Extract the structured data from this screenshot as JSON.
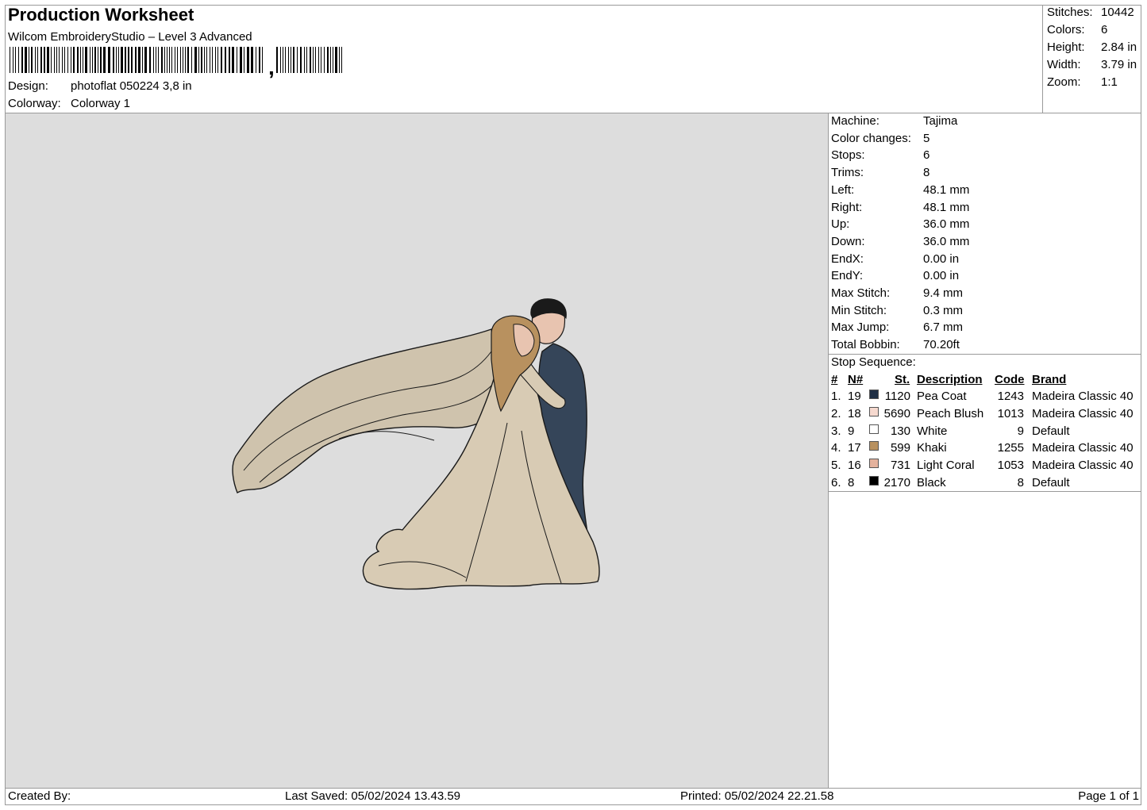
{
  "header": {
    "title": "Production Worksheet",
    "subtitle": "Wilcom EmbroideryStudio – Level 3 Advanced",
    "design_label": "Design:",
    "design_value": "photoflat 050224 3,8 in",
    "colorway_label": "Colorway:",
    "colorway_value": "Colorway 1"
  },
  "summary": [
    {
      "label": "Stitches:",
      "value": "10442"
    },
    {
      "label": "Colors:",
      "value": "6"
    },
    {
      "label": "Height:",
      "value": "2.84 in"
    },
    {
      "label": "Width:",
      "value": "3.79 in"
    },
    {
      "label": "Zoom:",
      "value": "1:1"
    }
  ],
  "machine_info": [
    {
      "label": "Machine:",
      "value": "Tajima"
    },
    {
      "label": "Color changes:",
      "value": "5"
    },
    {
      "label": "Stops:",
      "value": "6"
    },
    {
      "label": "Trims:",
      "value": "8"
    },
    {
      "label": "Left:",
      "value": "48.1 mm"
    },
    {
      "label": "Right:",
      "value": "48.1 mm"
    },
    {
      "label": "Up:",
      "value": "36.0 mm"
    },
    {
      "label": "Down:",
      "value": "36.0 mm"
    },
    {
      "label": "EndX:",
      "value": "0.00 in"
    },
    {
      "label": "EndY:",
      "value": "0.00 in"
    },
    {
      "label": "Max Stitch:",
      "value": "9.4 mm"
    },
    {
      "label": "Min Stitch:",
      "value": "0.3 mm"
    },
    {
      "label": "Max Jump:",
      "value": "6.7 mm"
    },
    {
      "label": "Total Bobbin:",
      "value": "70.20ft"
    }
  ],
  "stop_sequence": {
    "title": "Stop Sequence:",
    "columns": [
      "#",
      "N#",
      "St.",
      "Description",
      "Code",
      "Brand"
    ],
    "rows": [
      {
        "idx": "1.",
        "n": "19",
        "color": "#1f2f45",
        "st": "1120",
        "desc": "Pea Coat",
        "code": "1243",
        "brand": "Madeira Classic 40"
      },
      {
        "idx": "2.",
        "n": "18",
        "color": "#f6d9cf",
        "st": "5690",
        "desc": "Peach Blush",
        "code": "1013",
        "brand": "Madeira Classic 40"
      },
      {
        "idx": "3.",
        "n": "9",
        "color": "#ffffff",
        "st": "130",
        "desc": "White",
        "code": "9",
        "brand": "Default"
      },
      {
        "idx": "4.",
        "n": "17",
        "color": "#b8915f",
        "st": "599",
        "desc": "Khaki",
        "code": "1255",
        "brand": "Madeira Classic 40"
      },
      {
        "idx": "5.",
        "n": "16",
        "color": "#e4b29d",
        "st": "731",
        "desc": "Light Coral",
        "code": "1053",
        "brand": "Madeira Classic 40"
      },
      {
        "idx": "6.",
        "n": "8",
        "color": "#000000",
        "st": "2170",
        "desc": "Black",
        "code": "8",
        "brand": "Default"
      }
    ]
  },
  "footer": {
    "created_by": "Created By:",
    "last_saved": "Last Saved: 05/02/2024 13.43.59",
    "printed": "Printed: 05/02/2024 22.21.58",
    "page": "Page 1 of 1"
  },
  "design_colors": {
    "dress": "#d8cbb4",
    "veil": "#cfc3ad",
    "suit": "#354559",
    "hijab": "#b8915f",
    "skin": "#e8c4b0",
    "outline": "#1a1a1a"
  }
}
